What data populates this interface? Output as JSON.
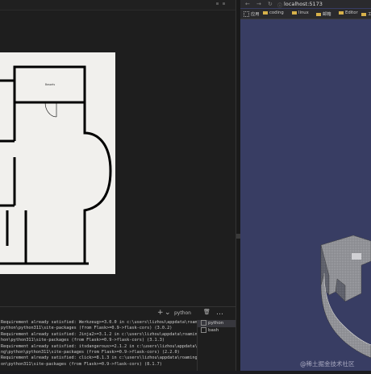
{
  "editor": {
    "preview_room_label": "Bassets",
    "panel_toolbar": {
      "add": "+",
      "split": "⌄",
      "terminal_name": "python",
      "trash": "🗑",
      "more": "…"
    },
    "terminal_lines": [
      "Requirement already satisfied: Werkzeug>=3.0.0 in c:\\users\\lizhou\\appdata\\roaming\\p",
      "python\\python311\\site-packages (from Flask>=0.9->flask-cors) (3.0.2)",
      "Requirement already satisfied: Jinja2>=3.1.2 in c:\\users\\lizhou\\appdata\\roaming\\pyt",
      "hon\\python311\\site-packages (from Flask>=0.9->flask-cors) (3.1.3)",
      "Requirement already satisfied: itsdangerous>=2.1.2 in c:\\users\\lizhou\\appdata\\roami",
      "ng\\python\\python311\\site-packages (from Flask>=0.9->flask-cors) (2.2.0)",
      "Requirement already satisfied: click>=8.1.3 in c:\\users\\lizhou\\appdata\\roaming\\pyth",
      "on\\python311\\site-packages (from Flask>=0.9->flask-cors) (8.1.7)"
    ],
    "terminal_list": [
      {
        "label": "python",
        "active": true
      },
      {
        "label": "bash",
        "active": false
      }
    ]
  },
  "browser": {
    "url": "localhost:5173",
    "bookmarks": [
      "应用",
      "coding",
      "linux",
      "邮箱",
      "Editor",
      "工具"
    ],
    "scene_background": "#383d63"
  },
  "watermark": "@稀土掘金技术社区"
}
